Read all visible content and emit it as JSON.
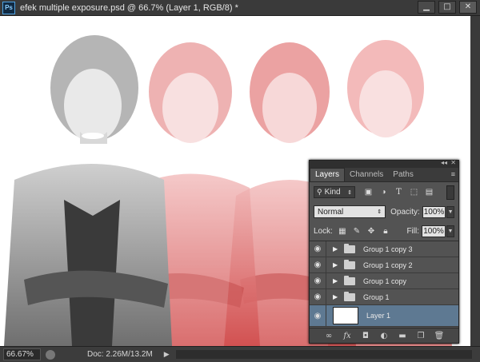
{
  "window": {
    "app_icon": "Ps",
    "title": "efek multiple exposure.psd @ 66.7% (Layer 1, RGB/8) *",
    "buttons": [
      "minimize-icon",
      "maximize-icon",
      "close-icon"
    ]
  },
  "status": {
    "zoom": "66.67%",
    "doc": "Doc: 2.26M/13.2M"
  },
  "layers_panel": {
    "tabs": [
      {
        "label": "Layers",
        "active": true
      },
      {
        "label": "Channels",
        "active": false
      },
      {
        "label": "Paths",
        "active": false
      }
    ],
    "filter_kind": "Kind",
    "blend_mode": "Normal",
    "opacity_label": "Opacity:",
    "opacity": "100%",
    "lock_label": "Lock:",
    "fill_label": "Fill:",
    "fill": "100%",
    "layers": [
      {
        "name": "Group 1 copy 3",
        "type": "group"
      },
      {
        "name": "Group 1 copy 2",
        "type": "group"
      },
      {
        "name": "Group 1 copy",
        "type": "group"
      },
      {
        "name": "Group 1",
        "type": "group"
      },
      {
        "name": "Layer 1",
        "type": "layer",
        "selected": true
      }
    ]
  },
  "colors": {
    "tint_red": "#e23b3b",
    "panel_bg": "#535353",
    "selected_layer": "#5e7992"
  }
}
